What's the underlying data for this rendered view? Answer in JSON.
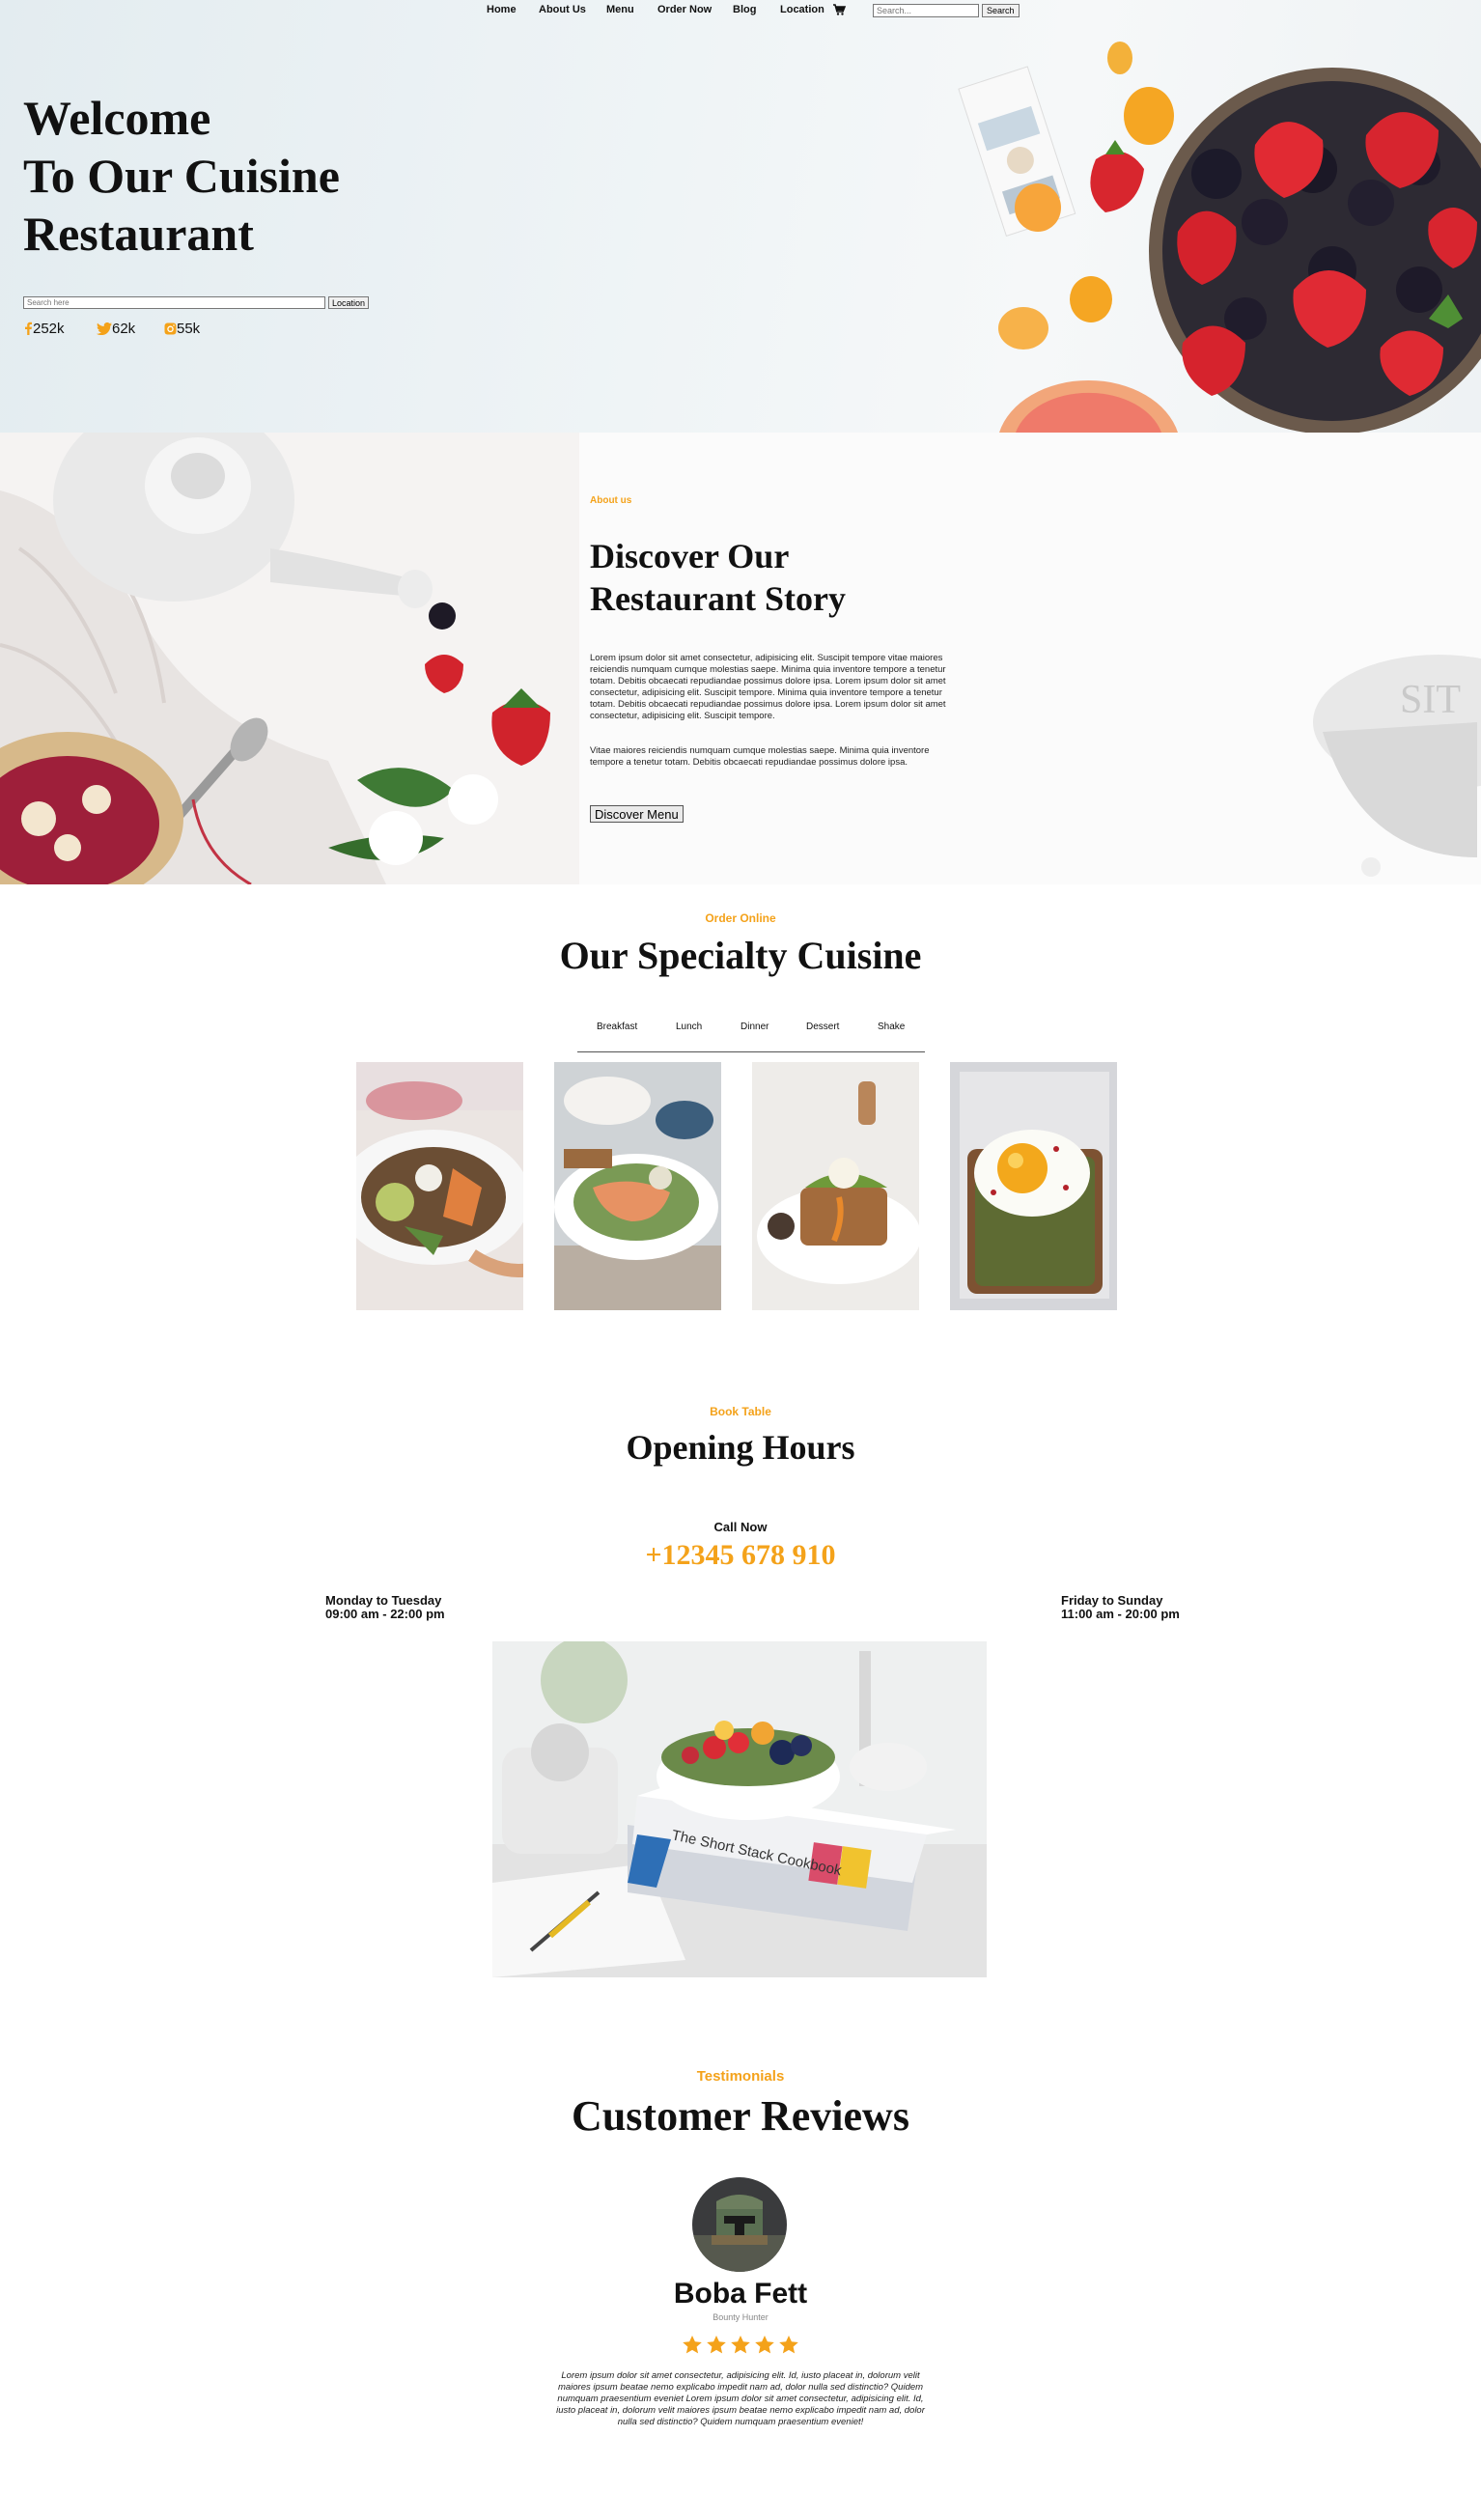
{
  "nav": {
    "items": [
      {
        "label": "Home"
      },
      {
        "label": "About Us"
      },
      {
        "label": "Menu"
      },
      {
        "label": "Order Now"
      },
      {
        "label": "Blog"
      },
      {
        "label": "Location"
      }
    ],
    "cart_icon": "cart-icon",
    "search_placeholder": "Search...",
    "search_button": "Search"
  },
  "hero": {
    "title_lines": [
      "Welcome",
      "To Our Cuisine",
      "Restaurant"
    ],
    "search_placeholder": "Search here",
    "location_button": "Location",
    "social": [
      {
        "icon": "facebook-icon",
        "count": "252k"
      },
      {
        "icon": "twitter-icon",
        "count": "62k"
      },
      {
        "icon": "instagram-icon",
        "count": "55k"
      }
    ]
  },
  "about": {
    "eyebrow": "About us",
    "title_lines": [
      "Discover Our",
      "Restaurant Story"
    ],
    "paragraph_1": "Lorem ipsum dolor sit amet consectetur, adipisicing elit. Suscipit tempore vitae maiores reiciendis numquam cumque molestias saepe. Minima quia inventore tempore a tenetur totam. Debitis obcaecati repudiandae possimus dolore ipsa. Lorem ipsum dolor sit amet consectetur, adipisicing elit. Suscipit tempore. Minima quia inventore tempore a tenetur totam. Debitis obcaecati repudiandae possimus dolore ipsa. Lorem ipsum dolor sit amet consectetur, adipisicing elit. Suscipit tempore.",
    "paragraph_2": "Vitae maiores reiciendis numquam cumque molestias saepe. Minima quia inventore tempore a tenetur totam. Debitis obcaecati repudiandae possimus dolore ipsa.",
    "button": "Discover Menu"
  },
  "specialty": {
    "eyebrow": "Order Online",
    "title": "Our Specialty Cuisine",
    "tabs": [
      {
        "label": "Breakfast"
      },
      {
        "label": "Lunch"
      },
      {
        "label": "Dinner"
      },
      {
        "label": "Dessert"
      },
      {
        "label": "Shake"
      }
    ]
  },
  "hours": {
    "eyebrow": "Book Table",
    "title": "Opening Hours",
    "call_label": "Call Now",
    "phone": "+12345 678 910",
    "left": {
      "days": "Monday to Tuesday",
      "time": "09:00 am - 22:00 pm"
    },
    "right": {
      "days": "Friday to Sunday",
      "time": "11:00 am - 20:00 pm"
    }
  },
  "reviews": {
    "eyebrow": "Testimonials",
    "title": "Customer Reviews",
    "name": "Boba Fett",
    "role": "Bounty Hunter",
    "rating": 5,
    "text": "Lorem ipsum dolor sit amet consectetur, adipisicing elit. Id, iusto placeat in, dolorum velit maiores ipsum beatae nemo explicabo impedit nam ad, dolor nulla sed distinctio? Quidem numquam praesentium eveniet Lorem ipsum dolor sit amet consectetur, adipisicing elit. Id, iusto placeat in, dolorum velit maiores ipsum beatae nemo explicabo impedit nam ad, dolor nulla sed distinctio? Quidem numquam praesentium eveniet!"
  },
  "colors": {
    "accent": "#f4a21a"
  }
}
